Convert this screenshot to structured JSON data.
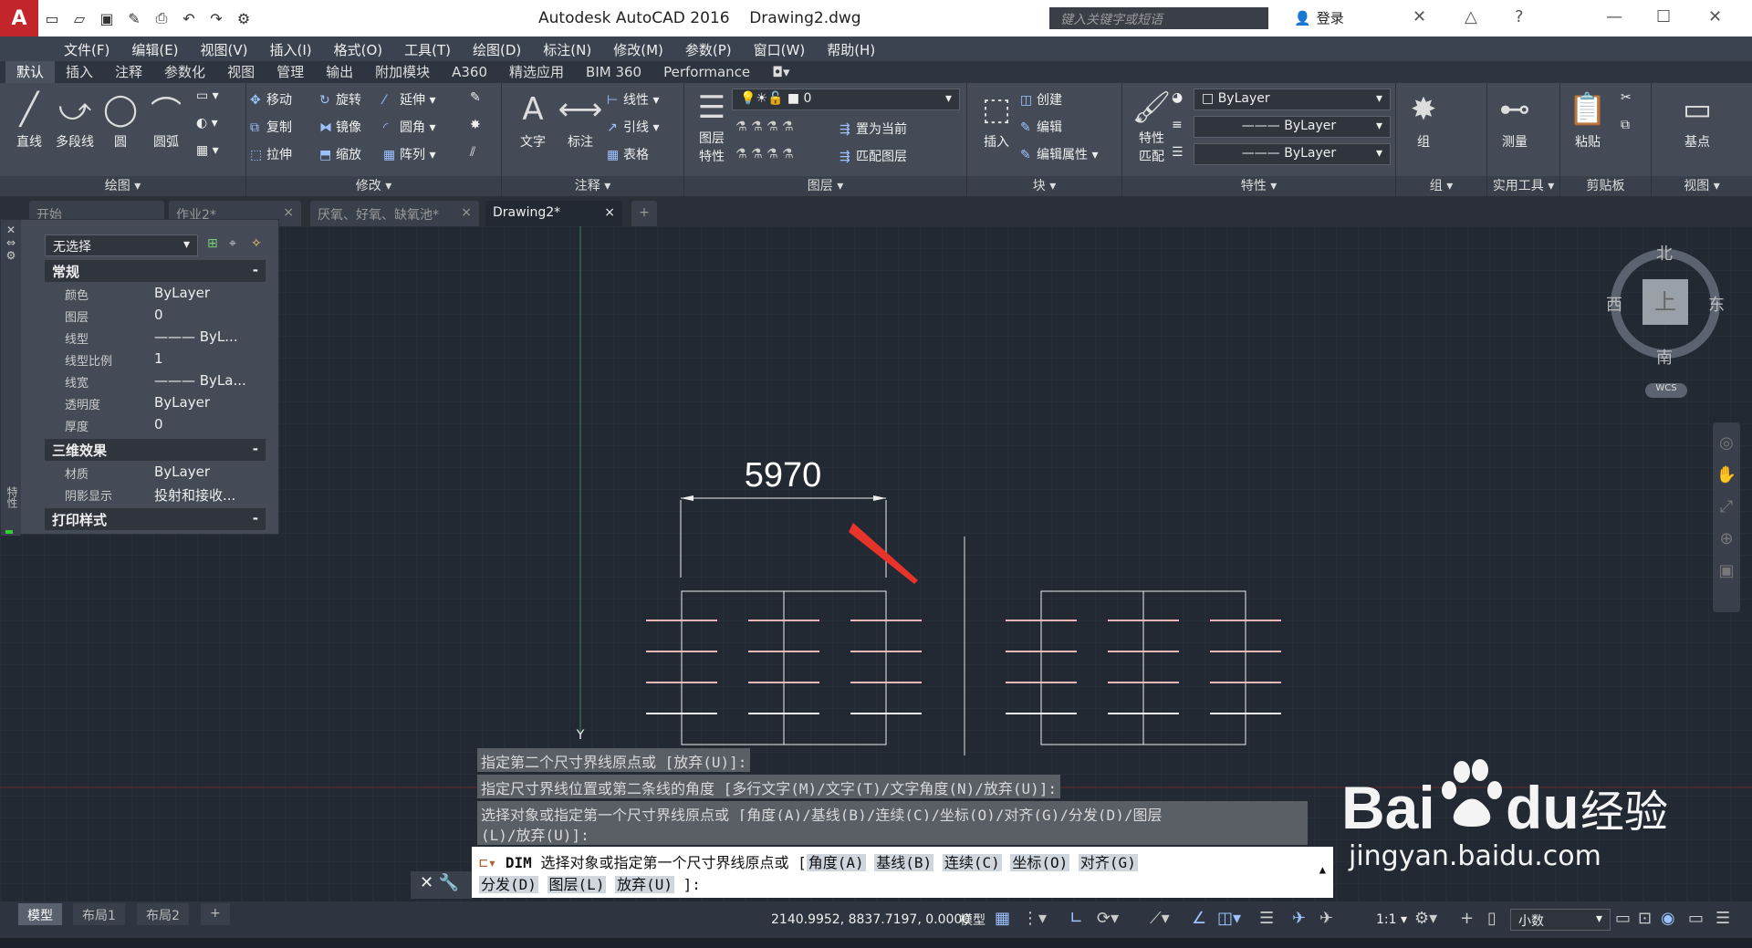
{
  "app": {
    "title": "Autodesk AutoCAD 2016",
    "document": "Drawing2.dwg"
  },
  "search": {
    "placeholder": "键入关键字或短语"
  },
  "login": {
    "label": "登录"
  },
  "menus": [
    "文件(F)",
    "编辑(E)",
    "视图(V)",
    "插入(I)",
    "格式(O)",
    "工具(T)",
    "绘图(D)",
    "标注(N)",
    "修改(M)",
    "参数(P)",
    "窗口(W)",
    "帮助(H)"
  ],
  "ribbon_tabs": [
    "默认",
    "插入",
    "注释",
    "参数化",
    "视图",
    "管理",
    "输出",
    "附加模块",
    "A360",
    "精选应用",
    "BIM 360",
    "Performance"
  ],
  "ribbon": {
    "draw": {
      "title": "绘图",
      "line": "直线",
      "polyline": "多段线",
      "circle": "圆",
      "arc": "圆弧"
    },
    "modify": {
      "title": "修改",
      "move": "移动",
      "rotate": "旋转",
      "trim": "延伸",
      "copy": "复制",
      "mirror": "镜像",
      "fillet": "圆角",
      "stretch": "拉伸",
      "scale": "缩放",
      "array": "阵列"
    },
    "annotation": {
      "title": "注释",
      "text": "文字",
      "dimension": "标注",
      "linear": "线性",
      "leader": "引线",
      "table": "表格"
    },
    "layers": {
      "title": "图层",
      "layer_props": "图层\n特性",
      "current_layer": "0",
      "set_current": "置为当前",
      "match_layer": "匹配图层"
    },
    "block": {
      "title": "块",
      "insert": "插入",
      "create": "创建",
      "edit": "编辑",
      "edit_attr": "编辑属性"
    },
    "properties": {
      "title": "特性",
      "match": "特性\n匹配",
      "color": "ByLayer",
      "linetype": "ByLayer",
      "lineweight": "ByLayer"
    },
    "groups": {
      "title": "组",
      "group": "组"
    },
    "utilities": {
      "title": "实用工具",
      "measure": "测量"
    },
    "clipboard": {
      "title": "剪贴板",
      "paste": "粘贴"
    },
    "view": {
      "title": "视图",
      "base": "基点"
    }
  },
  "doc_tabs": [
    "开始",
    "作业2*",
    "厌氧、好氧、缺氧池*",
    "Drawing2*"
  ],
  "properties_palette": {
    "selection": "无选择",
    "general_title": "常规",
    "general": [
      {
        "k": "颜色",
        "v": "ByLayer"
      },
      {
        "k": "图层",
        "v": "0"
      },
      {
        "k": "线型",
        "v": "——— ByL..."
      },
      {
        "k": "线型比例",
        "v": "1"
      },
      {
        "k": "线宽",
        "v": "——— ByLa..."
      },
      {
        "k": "透明度",
        "v": "ByLayer"
      },
      {
        "k": "厚度",
        "v": "0"
      }
    ],
    "effects_title": "三维效果",
    "effects": [
      {
        "k": "材质",
        "v": "ByLayer"
      },
      {
        "k": "阴影显示",
        "v": "投射和接收..."
      }
    ],
    "plot_title": "打印样式",
    "side_label": "特性"
  },
  "drawing": {
    "dimension_text": "5970",
    "ucs_y": "Y"
  },
  "viewcube": {
    "north": "北",
    "south": "南",
    "east": "东",
    "west": "西",
    "top": "上",
    "wcs": "WCS"
  },
  "command_history": [
    "指定第二个尺寸界线原点或 [放弃(U)]:",
    "指定尺寸界线位置或第二条线的角度 [多行文字(M)/文字(T)/文字角度(N)/放弃(U)]:",
    "选择对象或指定第一个尺寸界线原点或 [角度(A)/基线(B)/连续(C)/坐标(O)/对齐(G)/分发(D)/图层",
    "(L)/放弃(U)]:"
  ],
  "command_input": {
    "cmd": "DIM",
    "prompt": "选择对象或指定第一个尺寸界线原点或 [",
    "options_line1": [
      "角度(A)",
      "基线(B)",
      "连续(C)",
      "坐标(O)",
      "对齐(G)"
    ],
    "options_line2": [
      "分发(D)",
      "图层(L)",
      "放弃(U)"
    ],
    "end": "]:"
  },
  "layout_tabs": [
    "模型",
    "布局1",
    "布局2"
  ],
  "status": {
    "coords": "2140.9952, 8837.7197, 0.0000",
    "space": "模型",
    "scale": "1:1",
    "units": "小数"
  },
  "watermark": {
    "brand": "Bai",
    "brand2": "du",
    "cn": "经验",
    "url": "jingyan.baidu.com"
  }
}
